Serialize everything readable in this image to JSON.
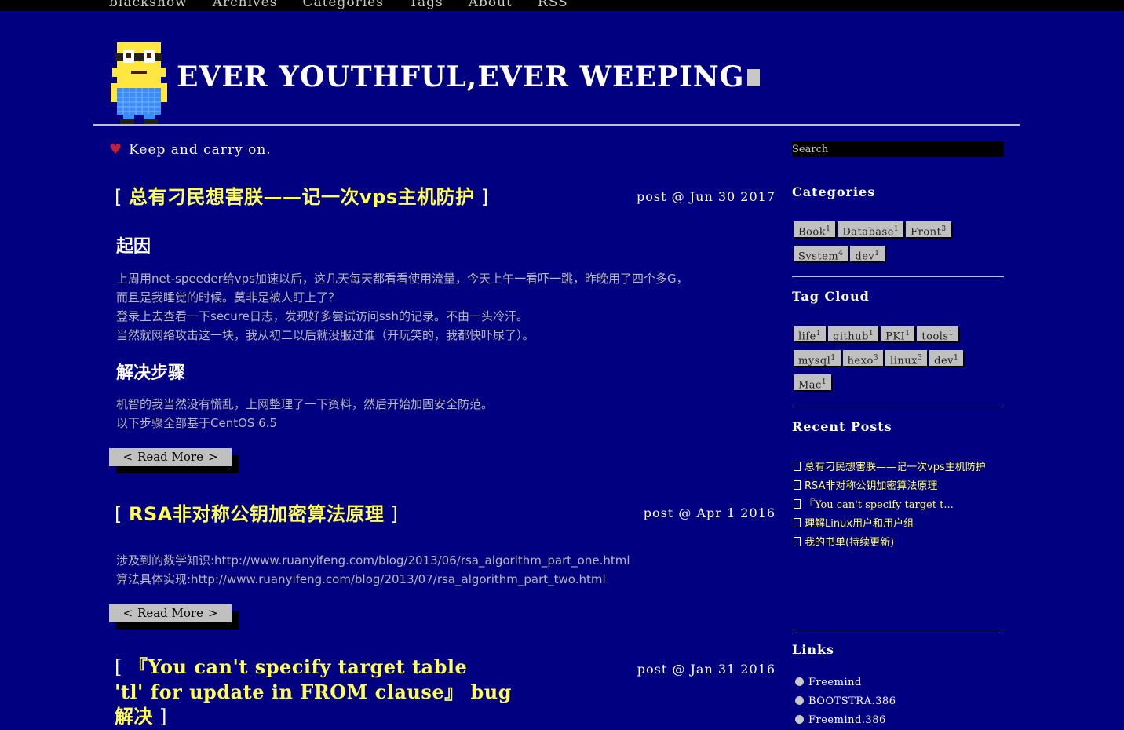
{
  "nav": {
    "brand": "blackshow",
    "items": [
      "Archives",
      "Categories",
      "Tags",
      "About",
      "RSS"
    ]
  },
  "header": {
    "title": "EVER YOUTHFUL,EVER WEEPING"
  },
  "tagline": "Keep and carry on.",
  "posts": [
    {
      "title": "总有刁民想害朕——记一次vps主机防护",
      "meta": "post @ Jun 30 2017",
      "sections": [
        {
          "heading": "起因",
          "lines": [
            "上周用net-speeder给vps加速以后，这几天每天都看看使用流量，今天上午一看吓一跳，昨晚用了四个多G，",
            "而且是我睡觉的时候。莫非是被人盯上了？",
            "登录上去查看一下secure日志，发现好多尝试访问ssh的记录。不由一头冷汗。",
            "当然就网络攻击这一块，我从初二以后就没服过谁（开玩笑的，我都快吓尿了）。"
          ]
        },
        {
          "heading": "解决步骤",
          "lines": [
            "机智的我当然没有慌乱，上网整理了一下资料，然后开始加固安全防范。",
            "以下步骤全部基于CentOS 6.5"
          ]
        }
      ],
      "read_more": "Read More"
    },
    {
      "title": "RSA非对称公钥加密算法原理",
      "meta": "post @ Apr 1 2016",
      "lines": [
        "涉及到的数学知识:http://www.ruanyifeng.com/blog/2013/06/rsa_algorithm_part_one.html",
        "算法具体实现:http://www.ruanyifeng.com/blog/2013/07/rsa_algorithm_part_two.html"
      ],
      "read_more": "Read More"
    },
    {
      "title_lines": [
        "『You can't specify target table",
        "'tl' for update in FROM clause』 bug",
        "解决"
      ],
      "meta": "post @ Jan 31 2016"
    }
  ],
  "sidebar": {
    "search_placeholder": "Search",
    "categories_title": "Categories",
    "categories": [
      {
        "name": "Book",
        "count": "1"
      },
      {
        "name": "Database",
        "count": "1"
      },
      {
        "name": "Front",
        "count": "3"
      },
      {
        "name": "System",
        "count": "4"
      },
      {
        "name": "dev",
        "count": "1"
      }
    ],
    "tagcloud_title": "Tag Cloud",
    "tags": [
      {
        "name": "life",
        "count": "1"
      },
      {
        "name": "github",
        "count": "1"
      },
      {
        "name": "PKI",
        "count": "1"
      },
      {
        "name": "tools",
        "count": "1"
      },
      {
        "name": "mysql",
        "count": "1"
      },
      {
        "name": "hexo",
        "count": "3"
      },
      {
        "name": "linux",
        "count": "3"
      },
      {
        "name": "dev",
        "count": "1"
      },
      {
        "name": "Mac",
        "count": "1"
      }
    ],
    "recent_title": "Recent Posts",
    "recent": [
      "总有刁民想害朕——记一次vps主机防护",
      "RSA非对称公钥加密算法原理",
      "『You can't specify target t...",
      "理解Linux用户和用户组",
      "我的书单(持续更新)"
    ],
    "links_title": "Links",
    "links": [
      "Freemind",
      "BOOTSTRA.386",
      "Freemind.386"
    ]
  }
}
